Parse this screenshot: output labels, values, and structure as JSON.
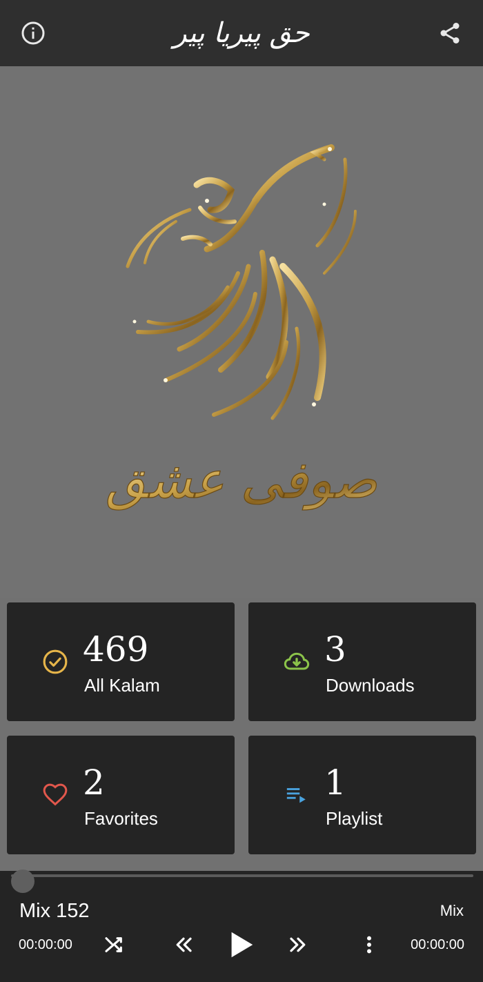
{
  "header": {
    "title": "حق پیریا پیر",
    "info_icon": "info-circle-icon",
    "share_icon": "share-icon"
  },
  "hero": {
    "artwork": "whirling-dervish-gold-artwork",
    "calligraphy": "صوفی عشق",
    "accent_color": "#c9a24a"
  },
  "stats": [
    {
      "count": "469",
      "label": "All Kalam",
      "icon": "check-circle-icon",
      "color": "#e6b54a"
    },
    {
      "count": "3",
      "label": "Downloads",
      "icon": "cloud-download-icon",
      "color": "#8bc34a"
    },
    {
      "count": "2",
      "label": "Favorites",
      "icon": "heart-icon",
      "color": "#e2574c"
    },
    {
      "count": "1",
      "label": "Playlist",
      "icon": "playlist-icon",
      "color": "#4aa3df"
    }
  ],
  "player": {
    "track_name": "Mix 152",
    "track_type": "Mix",
    "elapsed": "00:00:00",
    "total": "00:00:00",
    "progress": 0,
    "controls": [
      "shuffle-icon",
      "rewind-icon",
      "play-icon",
      "fast-forward-icon",
      "more-vertical-icon"
    ]
  }
}
